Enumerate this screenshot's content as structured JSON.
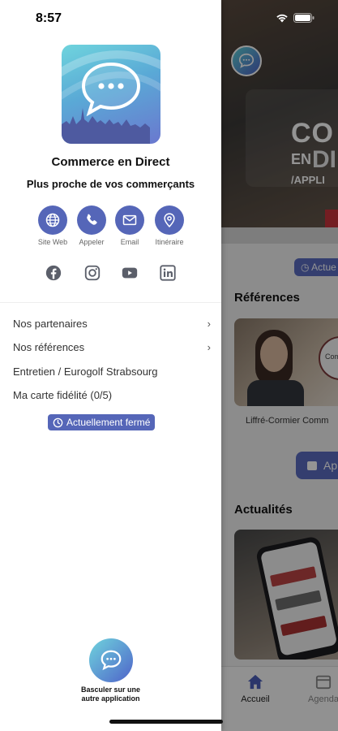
{
  "status_bar": {
    "time": "8:57"
  },
  "drawer": {
    "app_name": "Commerce en Direct",
    "tagline": "Plus proche de vos commerçants",
    "actions": [
      {
        "label": "Site Web",
        "icon": "globe-icon"
      },
      {
        "label": "Appeler",
        "icon": "phone-icon"
      },
      {
        "label": "Email",
        "icon": "mail-icon"
      },
      {
        "label": "Itinéraire",
        "icon": "map-pin-icon"
      }
    ],
    "socials": [
      "facebook-icon",
      "instagram-icon",
      "youtube-icon",
      "linkedin-icon"
    ],
    "menu": [
      {
        "label": "Nos partenaires",
        "chevron": "›"
      },
      {
        "label": "Nos références",
        "chevron": "›"
      },
      {
        "label": "Entretien / Eurogolf Strabsourg"
      },
      {
        "label": "Ma carte fidélité (0/5)"
      }
    ],
    "status_label": "Actuellement fermé",
    "switch_app_line1": "Basculer sur une",
    "switch_app_line2": "autre application"
  },
  "background": {
    "hero_text_1": "CO",
    "hero_text_2": "EN",
    "hero_text_3": "DI",
    "hero_text_4": "/APPLI",
    "status_pill": "Actue",
    "section_references": "Références",
    "card_caption": "Liffré-Cormier Comm",
    "card_circle_text": "Comi",
    "button_label": "Ap",
    "section_news": "Actualités",
    "tabs": [
      "Accueil",
      "Agenda"
    ]
  },
  "colors": {
    "accent": "#5566b8",
    "overlay": "rgba(0,0,0,0.42)"
  }
}
